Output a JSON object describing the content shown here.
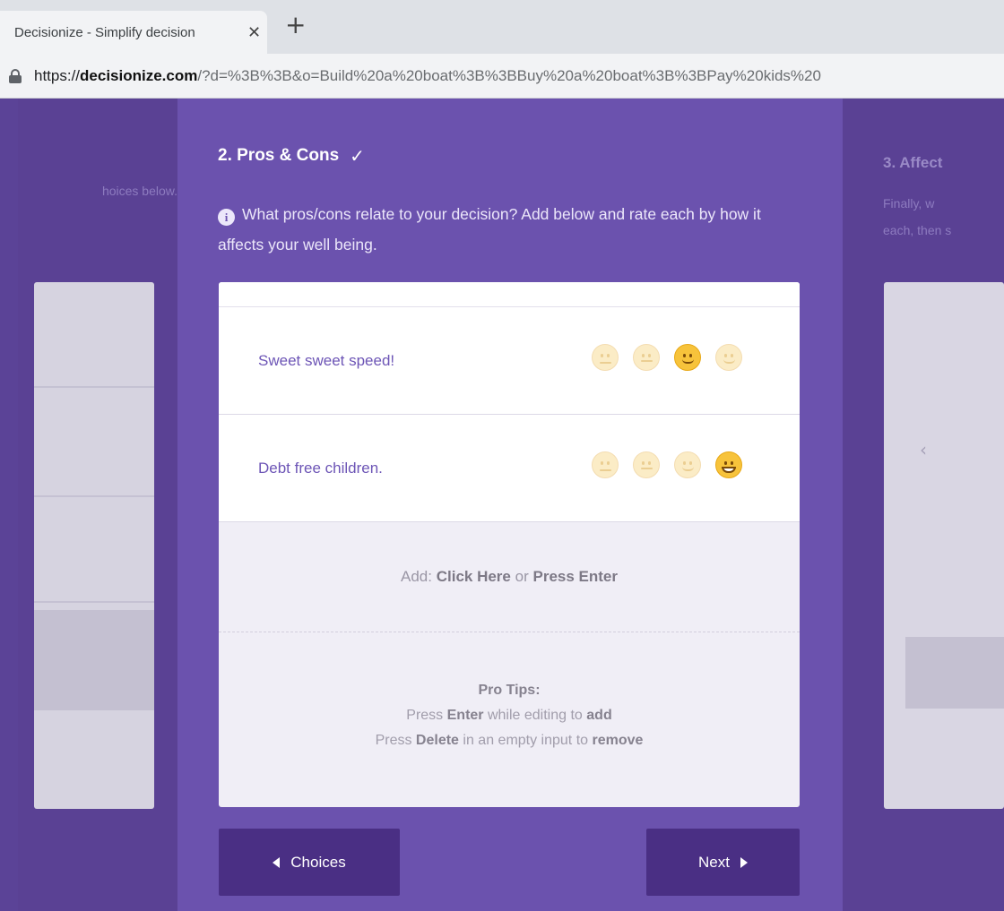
{
  "browser": {
    "tab_title": "Decisionize - Simplify decision",
    "tab_close": "✕",
    "new_tab": "+",
    "url_base": "https://",
    "url_domain": "decisionize.com",
    "url_rest": "/?d=%3B%3B&o=Build%20a%20boat%3B%3BBuy%20a%20boat%3B%3BPay%20kids%20"
  },
  "left_panel": {
    "text": "hoices below."
  },
  "main": {
    "step_title": "2. Pros & Cons",
    "check_icon": "✓",
    "info_icon": "i",
    "description": "What pros/cons relate to your decision? Add below and rate each by how it affects your well being.",
    "items": [
      {
        "label": "Sweet sweet speed!",
        "rating": 3,
        "rating_max": 4
      },
      {
        "label": "Debt free children.",
        "rating": 4,
        "rating_max": 4
      }
    ],
    "add_prefix": "Add: ",
    "add_click": "Click Here",
    "add_or": " or ",
    "add_enter": "Press Enter",
    "tips_title": "Pro Tips:",
    "tip1_a": "Press ",
    "tip1_b": "Enter",
    "tip1_c": " while editing to ",
    "tip1_d": "add",
    "tip2_a": "Press ",
    "tip2_b": "Delete",
    "tip2_c": " in an empty input to ",
    "tip2_d": "remove",
    "back_label": "Choices",
    "next_label": "Next"
  },
  "right_panel": {
    "title": "3. Affect",
    "text1": "Finally, w",
    "text2": "each, then s"
  },
  "colors": {
    "page_bg": "#5b4397",
    "main_bg": "#6b52ae",
    "button_bg": "#4a2f84",
    "item_text": "#6d55b6",
    "active_face": "#f7c33b"
  }
}
